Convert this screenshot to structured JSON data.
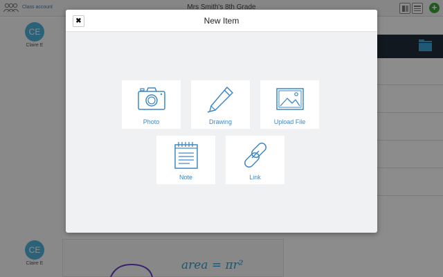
{
  "app": {
    "title": "Mrs Smith's 8th Grade",
    "class_account_label": "Class account",
    "add_button_label": "+"
  },
  "feed": {
    "posts": [
      {
        "avatar_initials": "CE",
        "author": "Claire E"
      },
      {
        "avatar_initials": "CE",
        "author": "Claire E"
      }
    ],
    "sketch_text": "area = πr²"
  },
  "modal": {
    "title": "New Item",
    "close_label": "✖",
    "options": [
      {
        "label": "Photo",
        "icon": "camera-icon"
      },
      {
        "label": "Drawing",
        "icon": "pencil-icon"
      },
      {
        "label": "Upload File",
        "icon": "image-file-icon"
      },
      {
        "label": "Note",
        "icon": "notepad-icon"
      },
      {
        "label": "Link",
        "icon": "chain-link-icon"
      }
    ]
  },
  "colors": {
    "accent": "#3d87c4",
    "avatar": "#4fb3d9",
    "add_button": "#3ea33f",
    "modal_background": "#f0f1f3"
  }
}
